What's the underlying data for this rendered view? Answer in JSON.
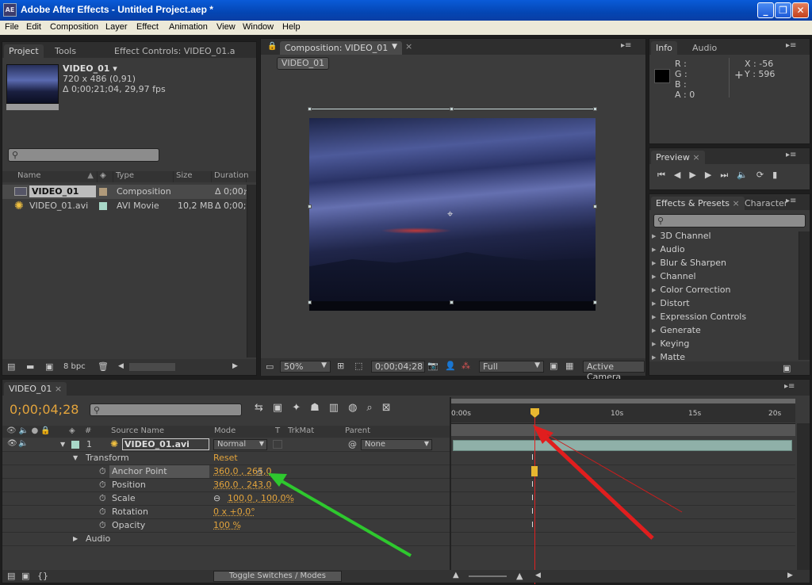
{
  "window": {
    "title": "Adobe After Effects - Untitled Project.aep *",
    "app_icon": "AE"
  },
  "menu": [
    "File",
    "Edit",
    "Composition",
    "Layer",
    "Effect",
    "Animation",
    "View",
    "Window",
    "Help"
  ],
  "project_panel": {
    "tabs": [
      "Project",
      "Tools",
      "Effect Controls: VIDEO_01.a"
    ],
    "selected_name": "VIDEO_01 ▾",
    "size_info": "720 x 486 (0,91)",
    "duration_info": "Δ 0;00;21;04, 29,97 fps",
    "columns": [
      "Name",
      "Type",
      "Size",
      "Duration"
    ],
    "items": [
      {
        "name": "VIDEO_01",
        "type": "Composition",
        "size": "",
        "duration": "Δ 0;00;",
        "label_color": "#b09a7a"
      },
      {
        "name": "VIDEO_01.avi",
        "type": "AVI Movie",
        "size": "10,2 MB",
        "duration": "Δ 0;00;",
        "label_color": "#a8d8c8"
      }
    ],
    "bpc": "8 bpc"
  },
  "composition_panel": {
    "tab": "Composition: VIDEO_01",
    "comp_button": "VIDEO_01",
    "zoom": "50%",
    "timecode": "0;00;04;28",
    "resolution": "Full",
    "camera": "Active Camera"
  },
  "info_panel": {
    "tabs": [
      "Info",
      "Audio"
    ],
    "r": "R :",
    "g": "G :",
    "b": "B :",
    "a": "A :  0",
    "x": "X : -56",
    "y": "Y : 596"
  },
  "preview_panel": {
    "tab": "Preview"
  },
  "effects_panel": {
    "tabs": [
      "Effects & Presets",
      "Character"
    ],
    "items": [
      "3D Channel",
      "Audio",
      "Blur & Sharpen",
      "Channel",
      "Color Correction",
      "Distort",
      "Expression Controls",
      "Generate",
      "Keying",
      "Matte"
    ]
  },
  "timeline": {
    "tab": "VIDEO_01",
    "timecode": "0;00;04;28",
    "columns": {
      "num": "#",
      "source": "Source Name",
      "mode": "Mode",
      "t": "T",
      "trkmat": "TrkMat",
      "parent": "Parent"
    },
    "layer": {
      "num": "1",
      "name": "VIDEO_01.avi",
      "mode": "Normal",
      "parent": "None"
    },
    "transform_label": "Transform",
    "reset": "Reset",
    "properties": [
      {
        "name": "Anchor Point",
        "value": "360,0 , 265,0"
      },
      {
        "name": "Position",
        "value": "360,0 , 243,0"
      },
      {
        "name": "Scale",
        "value": "100,0 , 100,0%"
      },
      {
        "name": "Rotation",
        "value": "0 x +0,0°"
      },
      {
        "name": "Opacity",
        "value": "100 %"
      }
    ],
    "audio_label": "Audio",
    "ruler": [
      "0:00s",
      "",
      "10s",
      "15s",
      "20s"
    ],
    "toggle_button": "Toggle Switches / Modes"
  },
  "colors": {
    "accent_orange": "#e3a43c",
    "playhead": "#e02020",
    "arrow_green": "#2ec82e",
    "arrow_red": "#e01e1e"
  }
}
